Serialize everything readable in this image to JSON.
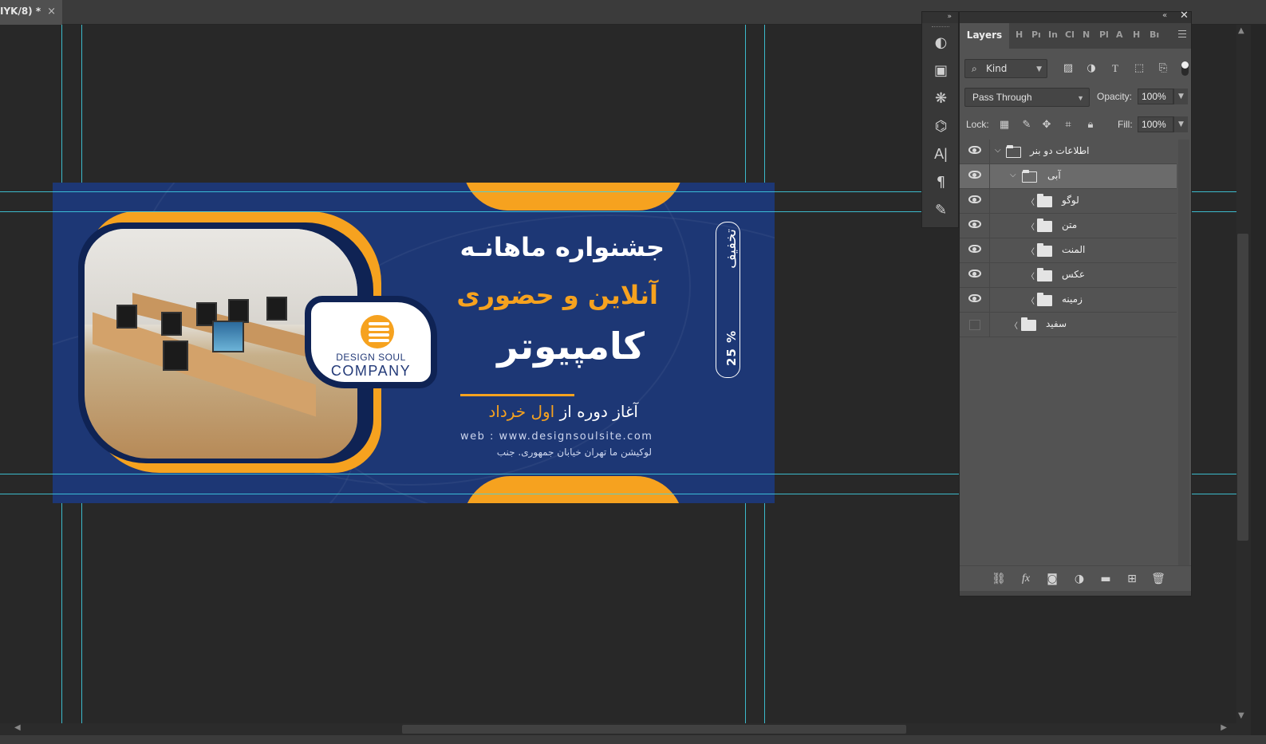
{
  "tab": {
    "title": "IYK/8) *",
    "close": "×"
  },
  "canvas": {
    "heading": "جشنواره ماهانـه",
    "subheading": "آنلاین و حضوری",
    "main_title": "کامپیوتر",
    "start_prefix": "آغاز دوره از",
    "start_highlight": "اول خرداد",
    "web": "web : www.designsoulsite.com",
    "address": "لوکیشن ما تهران خیابان جمهوری. جنب",
    "badge_percent": "25 %",
    "badge_label": "تخفیف",
    "logo_line1": "DESIGN SOUL",
    "logo_line2": "COMPANY",
    "colors": {
      "navy": "#1d3775",
      "orange": "#f6a21f"
    }
  },
  "tools": [
    "history-brush",
    "clone-source",
    "color-swatches",
    "pen-path",
    "character",
    "paragraph",
    "brush-settings"
  ],
  "layers_panel": {
    "tab_active": "Layers",
    "tabs_collapsed": [
      "H",
      "Pı",
      "In",
      "Cl",
      "N",
      "Pl",
      "A",
      "H",
      "Bı"
    ],
    "filter_kind": "Kind",
    "blend_mode": "Pass Through",
    "opacity_label": "Opacity:",
    "opacity_value": "100%",
    "lock_label": "Lock:",
    "fill_label": "Fill:",
    "fill_value": "100%",
    "layers": [
      {
        "name": "اطلاعات دو بنر",
        "visible": true,
        "expanded": true,
        "level": 0,
        "selected": false
      },
      {
        "name": "آبی",
        "visible": true,
        "expanded": true,
        "level": 1,
        "selected": true
      },
      {
        "name": "لوگو",
        "visible": true,
        "expanded": false,
        "level": 2,
        "selected": false
      },
      {
        "name": "متن",
        "visible": true,
        "expanded": false,
        "level": 2,
        "selected": false
      },
      {
        "name": "المنت",
        "visible": true,
        "expanded": false,
        "level": 2,
        "selected": false
      },
      {
        "name": "عکس",
        "visible": true,
        "expanded": false,
        "level": 2,
        "selected": false
      },
      {
        "name": "زمینه",
        "visible": true,
        "expanded": false,
        "level": 2,
        "selected": false
      },
      {
        "name": "سفید",
        "visible": false,
        "expanded": false,
        "level": 1,
        "selected": false
      }
    ]
  }
}
